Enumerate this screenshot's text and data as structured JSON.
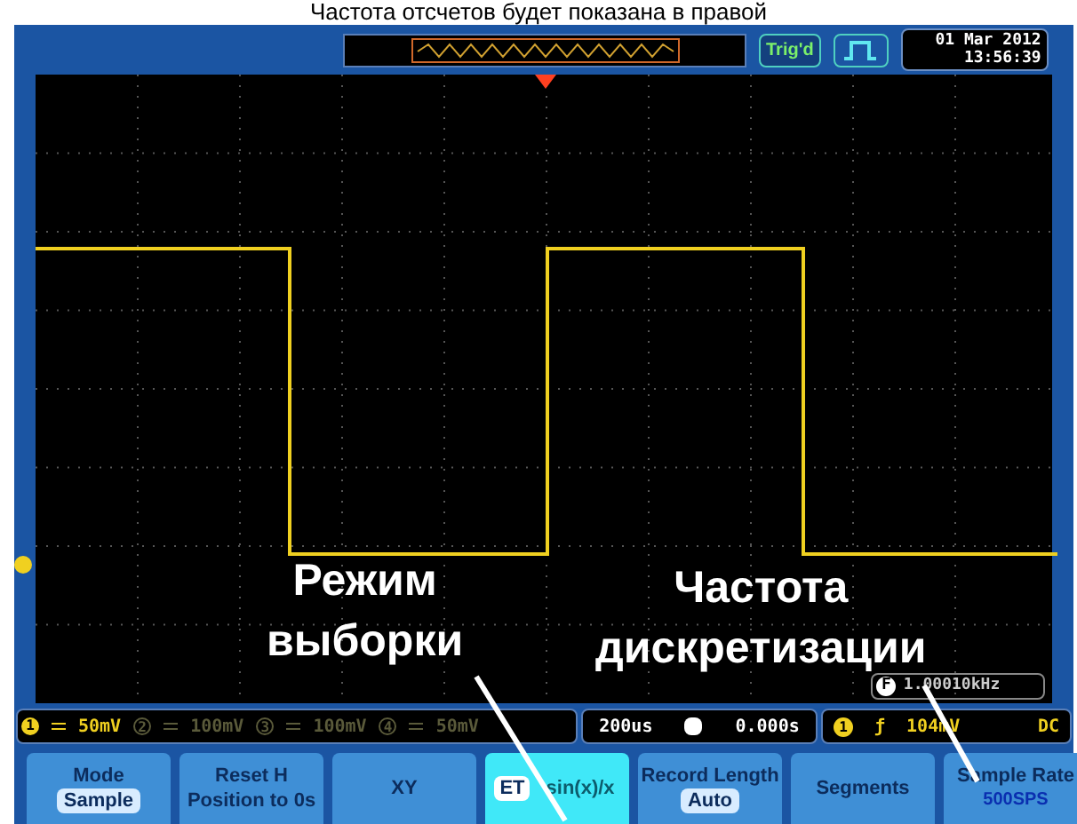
{
  "caption": "Частота отсчетов будет показана в правой",
  "header": {
    "trigger_status": "Trig'd",
    "date": "01 Mar 2012",
    "time": "13:56:39"
  },
  "annotations": [
    {
      "lines": [
        "Режим",
        "выборки"
      ]
    },
    {
      "lines": [
        "Частота",
        "дискретизации"
      ]
    }
  ],
  "frequency": {
    "badge": "F",
    "value": "1.00010kHz"
  },
  "channels": [
    {
      "label": "1",
      "scale": "50mV",
      "on": true
    },
    {
      "label": "2",
      "scale": "100mV",
      "on": false
    },
    {
      "label": "3",
      "scale": "100mV",
      "on": false
    },
    {
      "label": "4",
      "scale": "50mV",
      "on": false
    }
  ],
  "timebase": {
    "scale": "200us",
    "position": "0.000s"
  },
  "trigger": {
    "source": "1",
    "slope": "ƒ",
    "level": "104mV",
    "coupling": "DC"
  },
  "softkeys": [
    {
      "kind": "labeled",
      "title": "Mode",
      "value": "Sample"
    },
    {
      "kind": "text",
      "lines": [
        "Reset H",
        "Position to 0s"
      ]
    },
    {
      "kind": "text",
      "lines": [
        "XY"
      ]
    },
    {
      "kind": "toggle",
      "options": [
        {
          "label": "ET",
          "selected": true
        },
        {
          "label": "sin(x)/x",
          "selected": false
        }
      ]
    },
    {
      "kind": "labeled",
      "title": "Record Length",
      "value": "Auto"
    },
    {
      "kind": "text",
      "lines": [
        "Segments"
      ]
    },
    {
      "kind": "reading",
      "title": "Sample Rate",
      "value": "500SPS"
    }
  ]
}
